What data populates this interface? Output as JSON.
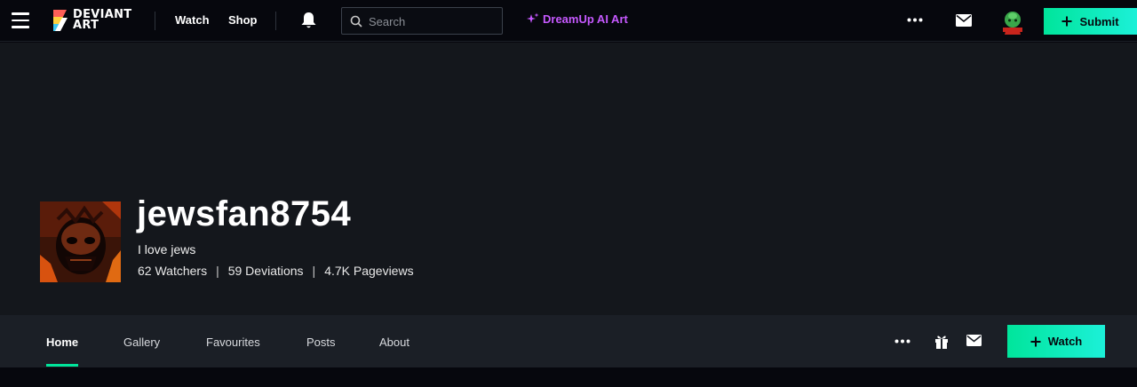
{
  "header": {
    "logo_line1": "DEVIANT",
    "logo_line2": "ART",
    "nav": [
      "Watch",
      "Shop"
    ],
    "search_placeholder": "Search",
    "dreamup_label": "DreamUp AI Art",
    "submit_label": "Submit"
  },
  "profile": {
    "username": "jewsfan8754",
    "tagline": "I love jews",
    "stats": [
      "62 Watchers",
      "59 Deviations",
      "4.7K Pageviews"
    ],
    "separator": "|"
  },
  "tabs": {
    "items": [
      "Home",
      "Gallery",
      "Favourites",
      "Posts",
      "About"
    ],
    "active": "Home",
    "watch_label": "Watch"
  },
  "colors": {
    "accent": "#00e59b",
    "dreamup": "#c659ff",
    "background": "#06070d",
    "banner": "#14171c",
    "tabbar": "#1b1f26"
  },
  "icons": [
    "menu-icon",
    "deviantart-logo",
    "bell-icon",
    "search-icon",
    "sparkle-icon",
    "more-icon",
    "mail-icon",
    "avatar",
    "plus-icon",
    "gift-icon"
  ]
}
